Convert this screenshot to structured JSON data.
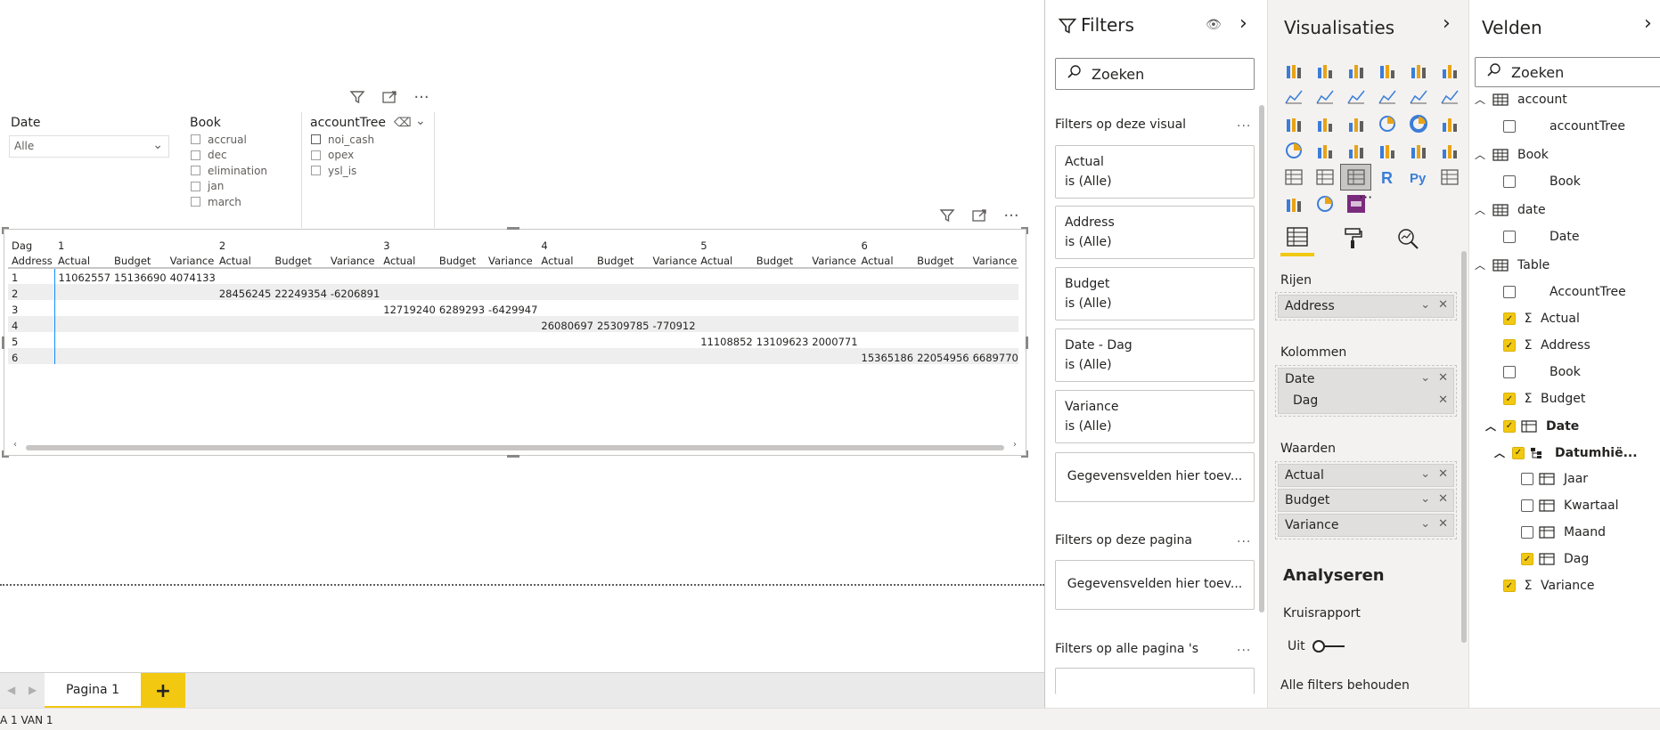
{
  "canvas": {
    "visual_more": "···",
    "slicers": {
      "date": {
        "title": "Date",
        "selected": "Alle"
      },
      "book": {
        "title": "Book",
        "items": [
          "accrual",
          "dec",
          "elimination",
          "jan",
          "march"
        ]
      },
      "account": {
        "title": "accountTree",
        "items": [
          "noi_cash",
          "opex",
          "ysl_is"
        ]
      }
    },
    "matrix": {
      "col_header_label": "Dag",
      "row_header_label": "Address",
      "day_groups": [
        "1",
        "2",
        "3",
        "4",
        "5",
        "6"
      ],
      "measures": [
        "Actual",
        "Budget",
        "Variance"
      ],
      "rows": [
        {
          "address": "1",
          "cells": [
            "11062557",
            "15136690",
            "4074133",
            "",
            "",
            "",
            "",
            "",
            "",
            "",
            "",
            "",
            "",
            "",
            "",
            "",
            "",
            ""
          ]
        },
        {
          "address": "2",
          "cells": [
            "",
            "",
            "",
            "28456245",
            "22249354",
            "-6206891",
            "",
            "",
            "",
            "",
            "",
            "",
            "",
            "",
            "",
            "",
            "",
            ""
          ]
        },
        {
          "address": "3",
          "cells": [
            "",
            "",
            "",
            "",
            "",
            "",
            "12719240",
            "6289293",
            "-6429947",
            "",
            "",
            "",
            "",
            "",
            "",
            "",
            "",
            ""
          ]
        },
        {
          "address": "4",
          "cells": [
            "",
            "",
            "",
            "",
            "",
            "",
            "",
            "",
            "",
            "26080697",
            "25309785",
            "-770912",
            "",
            "",
            "",
            "",
            "",
            ""
          ]
        },
        {
          "address": "5",
          "cells": [
            "",
            "",
            "",
            "",
            "",
            "",
            "",
            "",
            "",
            "",
            "",
            "",
            "11108852",
            "13109623",
            "2000771",
            "",
            "",
            ""
          ]
        },
        {
          "address": "6",
          "cells": [
            "",
            "",
            "",
            "",
            "",
            "",
            "",
            "",
            "",
            "",
            "",
            "",
            "",
            "",
            "",
            "15365186",
            "22054956",
            "6689770"
          ]
        }
      ]
    }
  },
  "tabs": {
    "page_label": "Pagina 1",
    "add_label": "+"
  },
  "status": {
    "text": "A 1 VAN 1"
  },
  "filters": {
    "title": "Filters",
    "search_placeholder": "Zoeken",
    "visual_section": "Filters op deze visual",
    "more": "...",
    "cards": [
      {
        "name": "Actual",
        "value": "is (Alle)"
      },
      {
        "name": "Address",
        "value": "is (Alle)"
      },
      {
        "name": "Budget",
        "value": "is (Alle)"
      },
      {
        "name": "Date - Dag",
        "value": "is (Alle)"
      },
      {
        "name": "Variance",
        "value": "is (Alle)"
      }
    ],
    "add_fields": "Gegevensvelden hier toev...",
    "page_section": "Filters op deze pagina",
    "all_pages_section": "Filters op alle pagina 's"
  },
  "visualizations": {
    "title": "Visualisaties",
    "more_visuals": "···",
    "wells": {
      "rows_label": "Rijen",
      "rows": [
        "Address"
      ],
      "columns_label": "Kolommen",
      "columns": [
        "Date",
        "Dag"
      ],
      "values_label": "Waarden",
      "values": [
        "Actual",
        "Budget",
        "Variance"
      ]
    },
    "analyze_title": "Analyseren",
    "drill_label": "Kruisrapport",
    "drill_value": "Uit",
    "keep_filters": "Alle filters behouden"
  },
  "fields": {
    "title": "Velden",
    "search_placeholder": "Zoeken",
    "tables": [
      {
        "name": "account",
        "fields": [
          {
            "name": "accountTree",
            "checked": false
          }
        ]
      },
      {
        "name": "Book",
        "fields": [
          {
            "name": "Book",
            "checked": false
          }
        ]
      },
      {
        "name": "date",
        "fields": [
          {
            "name": "Date",
            "checked": false
          }
        ]
      },
      {
        "name": "Table",
        "fields": [
          {
            "name": "AccountTree",
            "checked": false
          },
          {
            "name": "Actual",
            "checked": true
          },
          {
            "name": "Address",
            "checked": true
          },
          {
            "name": "Book",
            "checked": false
          },
          {
            "name": "Budget",
            "checked": true
          },
          {
            "name": "Date",
            "checked": true
          },
          {
            "name": "Datumhië...",
            "checked": true
          },
          {
            "name": "Jaar",
            "checked": false
          },
          {
            "name": "Kwartaal",
            "checked": false
          },
          {
            "name": "Maand",
            "checked": false
          },
          {
            "name": "Dag",
            "checked": true
          },
          {
            "name": "Variance",
            "checked": true
          }
        ]
      }
    ]
  },
  "colors": {
    "accent": "#f2c811",
    "selection_line": "#118dff"
  }
}
